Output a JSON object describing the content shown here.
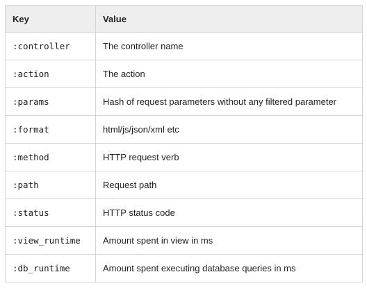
{
  "table": {
    "headers": {
      "key": "Key",
      "value": "Value"
    },
    "rows": [
      {
        "key": ":controller",
        "value": "The controller name"
      },
      {
        "key": ":action",
        "value": "The action"
      },
      {
        "key": ":params",
        "value": "Hash of request parameters without any filtered parameter"
      },
      {
        "key": ":format",
        "value": "html/js/json/xml etc"
      },
      {
        "key": ":method",
        "value": "HTTP request verb"
      },
      {
        "key": ":path",
        "value": "Request path"
      },
      {
        "key": ":status",
        "value": "HTTP status code"
      },
      {
        "key": ":view_runtime",
        "value": "Amount spent in view in ms"
      },
      {
        "key": ":db_runtime",
        "value": "Amount spent executing database queries in ms"
      }
    ]
  }
}
